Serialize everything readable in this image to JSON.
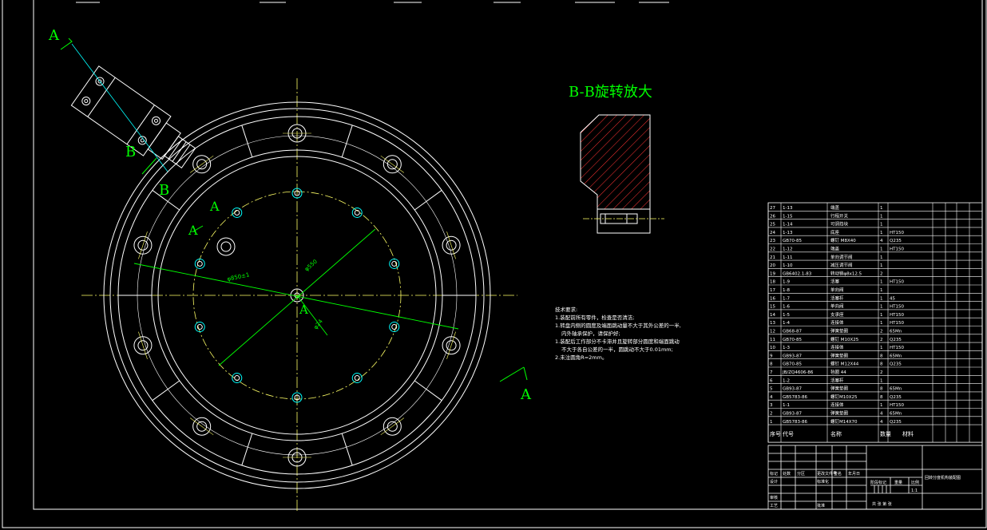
{
  "colors": {
    "background": "#000000",
    "line": "#ffffff",
    "dim": "#00ff00",
    "center": "#ffff66",
    "cyan": "#00ffff",
    "hatch": "#ff3333"
  },
  "labels": {
    "section_title": "B-B旋转放大",
    "cut_a_top": "A",
    "cut_a_bottom": "A",
    "cut_b_1": "B",
    "cut_b_2": "B",
    "view_a_1": "A",
    "view_a_2": "A",
    "center_a": "A",
    "dim_1": "φ850±1",
    "dim_2": "φ550",
    "dim_3": "φ24"
  },
  "notes": {
    "title": "技术要求:",
    "lines": [
      "1.装配前所有零件，检查是否清洁;",
      "1.转盘内侧的圆度及端面跳动量不大于其外公差的一半,",
      "  内外轴承保护，请保护好;",
      "1.装配后工作部分不卡滞并且旋转部分圆度和端面跳动",
      "  不大于各自公差的一半，圆跳动不大于0.01mm;",
      "2.未注圆角R=2mm。"
    ]
  },
  "bom": {
    "rows": [
      [
        "27",
        "1-13",
        "端盖",
        "1",
        ""
      ],
      [
        "26",
        "1-15",
        "行程开关",
        "1",
        ""
      ],
      [
        "25",
        "1-14",
        "可调挡块",
        "1",
        ""
      ],
      [
        "24",
        "1-13",
        "底座",
        "1",
        "HT150"
      ],
      [
        "23",
        "GB70-85",
        "螺钉 M8X40",
        "4",
        "Q235"
      ],
      [
        "22",
        "1-12",
        "端盖",
        "1",
        "HT150"
      ],
      [
        "21",
        "1-11",
        "单向调节阀",
        "1",
        ""
      ],
      [
        "20",
        "1-10",
        "减压调节阀",
        "1",
        ""
      ],
      [
        "19",
        "GB6402.1-83",
        "转动销φ8x12.5",
        "2",
        ""
      ],
      [
        "18",
        "1-9",
        "活塞",
        "1",
        "HT150"
      ],
      [
        "17",
        "1-8",
        "单向阀",
        "1",
        ""
      ],
      [
        "16",
        "1-7",
        "活塞杆",
        "1",
        "45"
      ],
      [
        "15",
        "1-6",
        "单向阀",
        "1",
        "HT150"
      ],
      [
        "14",
        "1-5",
        "支承座",
        "1",
        "HT150"
      ],
      [
        "13",
        "1-4",
        "连接体",
        "1",
        "HT150"
      ],
      [
        "12",
        "GB68-87",
        "弹簧垫圈",
        "2",
        "65Mn"
      ],
      [
        "11",
        "GB70-85",
        "螺钉 M10X25",
        "2",
        "Q235"
      ],
      [
        "10",
        "1-3",
        "连接体",
        "1",
        "HT150"
      ],
      [
        "9",
        "GB93-87",
        "弹簧垫圈",
        "8",
        "65Mn"
      ],
      [
        "8",
        "GB70-85",
        "螺钉 M12X44",
        "8",
        "Q235"
      ],
      [
        "7",
        "JB/ZQ4606-86",
        "毡圈 44",
        "2",
        ""
      ],
      [
        "6",
        "1-2",
        "活塞杆",
        "1",
        ""
      ],
      [
        "5",
        "GB93-87",
        "弹簧垫圈",
        "8",
        "65Mn"
      ],
      [
        "4",
        "GB5783-86",
        "螺钉M10X25",
        "8",
        "Q235"
      ],
      [
        "3",
        "1-1",
        "连接体",
        "1",
        "HT150"
      ],
      [
        "2",
        "GB93-87",
        "弹簧垫圈",
        "4",
        "65Mn"
      ],
      [
        "1",
        "GB5783-86",
        "螺钉M14X70",
        "4",
        "Q235"
      ]
    ],
    "header": [
      "序号",
      "代号",
      "名称",
      "数量",
      "材料"
    ],
    "title_block": {
      "drawing_name": "回转分度机构装配图",
      "mark": "标记",
      "count": "处数",
      "zone": "分区",
      "change_doc": "更改文件号",
      "sign": "签名",
      "date": "年月日",
      "design": "设计",
      "standard": "标准化",
      "stage": "阶段标记",
      "weight": "重量",
      "scale": "比例",
      "review": "审核",
      "process": "工艺",
      "approve": "批准",
      "sheet": "共 张 第 张",
      "scale_val": "1:1"
    }
  }
}
